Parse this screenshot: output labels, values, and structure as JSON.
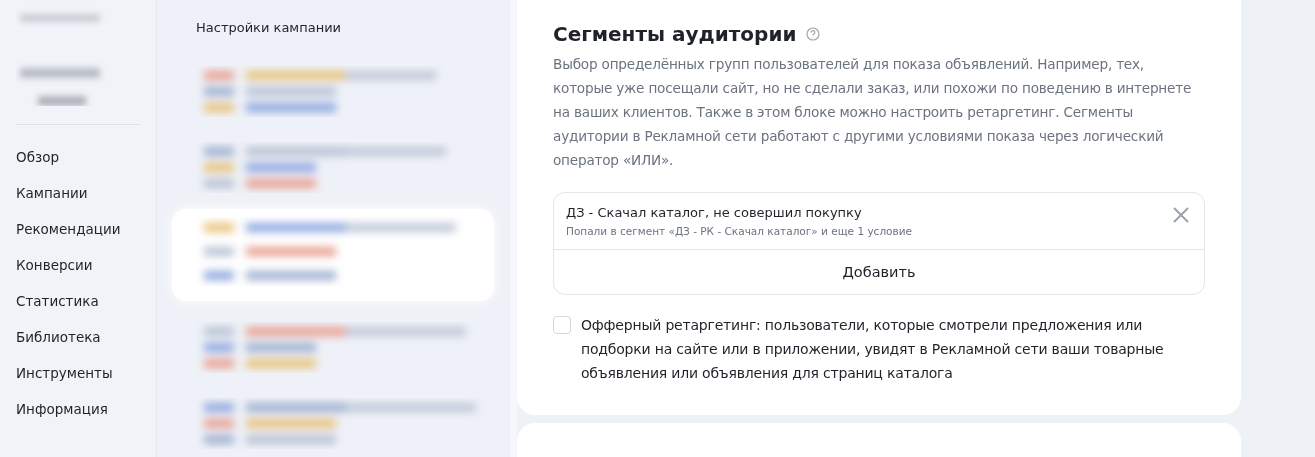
{
  "nav": {
    "items": [
      {
        "label": "Обзор"
      },
      {
        "label": "Кампании"
      },
      {
        "label": "Рекомендации"
      },
      {
        "label": "Конверсии"
      },
      {
        "label": "Статистика"
      },
      {
        "label": "Библиотека"
      },
      {
        "label": "Инструменты"
      },
      {
        "label": "Информация"
      }
    ]
  },
  "campaigns": {
    "title": "Настройки кампании",
    "items": [
      {
        "selected": false
      },
      {
        "selected": false
      },
      {
        "selected": true
      },
      {
        "selected": false
      },
      {
        "selected": false
      }
    ]
  },
  "section": {
    "title": "Сегменты аудитории",
    "description": "Выбор определённых групп пользователей для показа объявлений. Например, тех, которые уже посещали сайт, но не сделали заказ, или похожи по поведению в интернете на ваших клиентов. Также в этом блоке можно настроить ретаргетинг. Сегменты аудитории в Рекламной сети работают с другими условиями показа через логический оператор «ИЛИ».",
    "segments": [
      {
        "name": "ДЗ - Скачал каталог, не совершил покупку",
        "detail": "Попали в сегмент «ДЗ - РК - Скачал каталог» и еще 1 условие"
      }
    ],
    "add_button": "Добавить",
    "offer_retargeting": {
      "checked": false,
      "label": "Офферный ретаргетинг: пользователи, которые смотрели предложения или подборки на сайте или в приложении, увидят в Рекламной сети ваши товарные объявления или объявления для страниц каталога"
    }
  }
}
